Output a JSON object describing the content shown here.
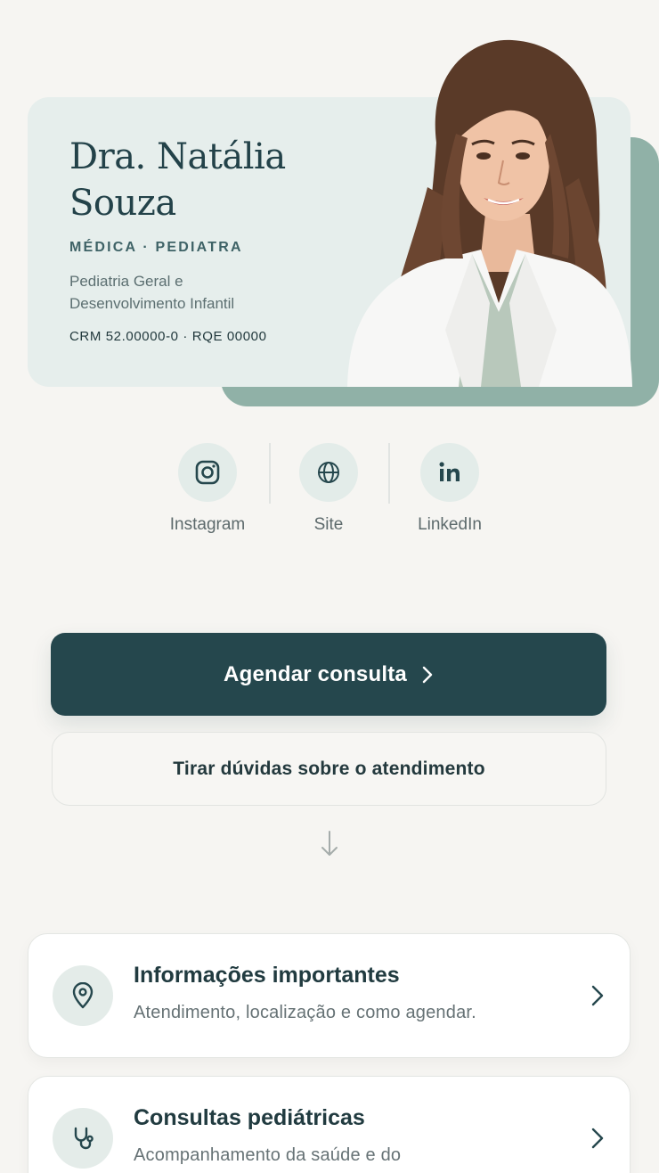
{
  "profile": {
    "name_line1": "Dra. Natália",
    "name_line2": "Souza",
    "role": "MÉDICA · PEDIATRA",
    "specialty_line1": "Pediatria Geral e",
    "specialty_line2": "Desenvolvimento Infantil",
    "registration": "CRM 52.00000-0 · RQE 00000"
  },
  "social": [
    {
      "label": "Instagram",
      "icon": "instagram-icon"
    },
    {
      "label": "Site",
      "icon": "globe-icon"
    },
    {
      "label": "LinkedIn",
      "icon": "linkedin-icon"
    }
  ],
  "actions": {
    "primary_label": "Agendar consulta",
    "secondary_label": "Tirar dúvidas sobre o atendimento"
  },
  "cards": [
    {
      "title": "Informações importantes",
      "subtitle": "Atendimento, localização e como agendar.",
      "icon": "location-pin-icon"
    },
    {
      "title": "Consultas pediátricas",
      "subtitle": "Acompanhamento da saúde e do",
      "icon": "stethoscope-icon"
    }
  ],
  "colors": {
    "background": "#f6f5f2",
    "primary": "#25474d",
    "hero_card": "#e6eeec",
    "hero_accent": "#90b1a7",
    "icon_circle": "#e3ece9"
  }
}
